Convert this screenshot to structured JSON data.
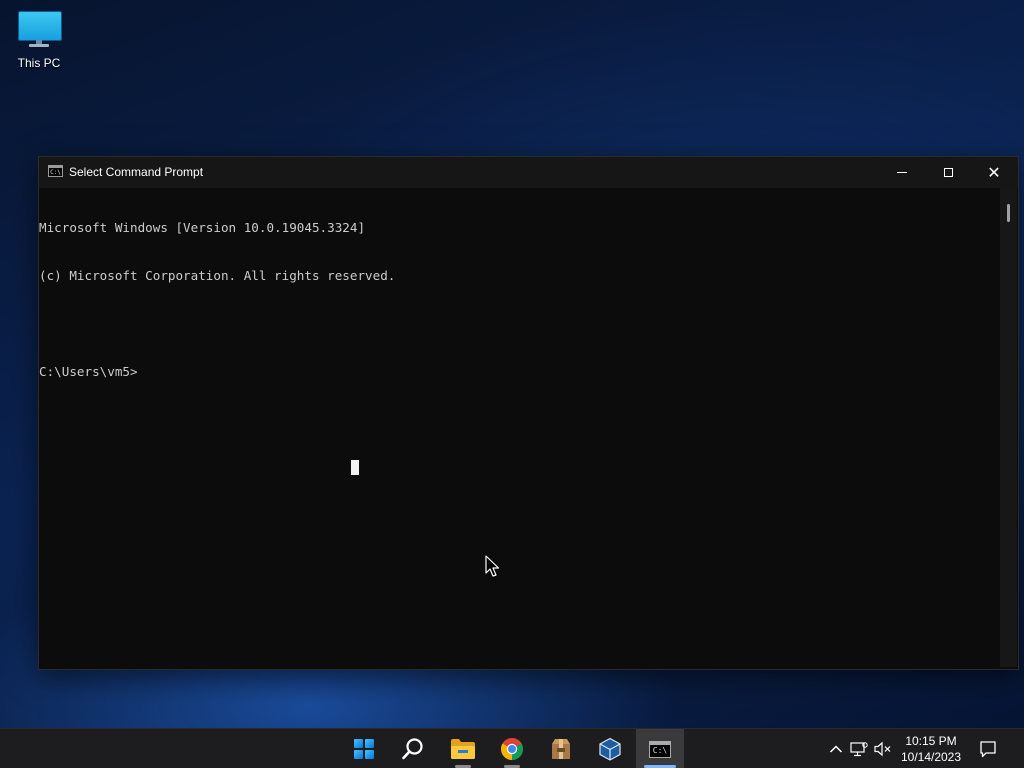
{
  "desktop": {
    "icons": [
      {
        "label": "This PC",
        "icon": "this-pc-icon"
      }
    ]
  },
  "window": {
    "title": "Select Command Prompt",
    "title_icon_text": "C:\\",
    "controls": [
      "minimize",
      "maximize",
      "close"
    ],
    "console_lines": [
      "Microsoft Windows [Version 10.0.19045.3324]",
      "(c) Microsoft Corporation. All rights reserved.",
      "",
      "C:\\Users\\vm5>"
    ]
  },
  "taskbar": {
    "items": [
      {
        "name": "start",
        "icon": "windows-start-icon"
      },
      {
        "name": "search",
        "icon": "search-icon"
      },
      {
        "name": "file-explorer",
        "icon": "folder-icon",
        "running": true
      },
      {
        "name": "chrome",
        "icon": "chrome-icon",
        "running": true
      },
      {
        "name": "archive-app",
        "icon": "package-icon"
      },
      {
        "name": "virtualbox",
        "icon": "cube-icon"
      },
      {
        "name": "command-prompt",
        "icon": "cmd-icon",
        "label": "C:\\",
        "active": true
      }
    ],
    "tray": {
      "icons": [
        "chevron-up-icon",
        "network-icon",
        "volume-muted-icon"
      ],
      "time": "10:15 PM",
      "date": "10/14/2023",
      "notification_icon": "notification-icon"
    }
  },
  "colors": {
    "console_bg": "#0c0c0c",
    "console_text": "#cccccc",
    "titlebar_bg": "#161616",
    "taskbar_bg": "#1d1d1f",
    "accent": "#0078d4"
  }
}
